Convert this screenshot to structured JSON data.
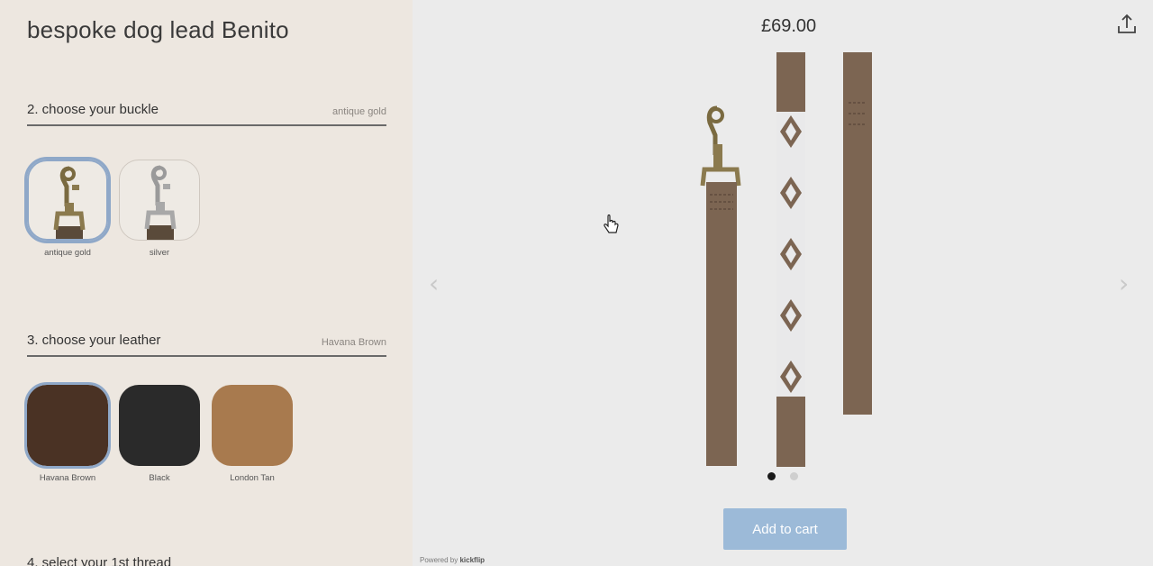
{
  "product": {
    "title": "bespoke dog lead Benito",
    "price": "£69.00"
  },
  "buckle": {
    "heading": "2. choose your buckle",
    "selected": "antique gold",
    "options": [
      {
        "label": "antique gold",
        "color": "#8b7a4e"
      },
      {
        "label": "silver",
        "color": "#9a9a9a"
      }
    ]
  },
  "leather": {
    "heading": "3. choose your leather",
    "selected": "Havana Brown",
    "options": [
      {
        "label": "Havana Brown",
        "color": "#4a3224"
      },
      {
        "label": "Black",
        "color": "#2a2a2a"
      },
      {
        "label": "London Tan",
        "color": "#a87a4e"
      }
    ]
  },
  "thread": {
    "heading": "4. select your 1st thread"
  },
  "viewer": {
    "add_to_cart": "Add to cart",
    "powered_by": "Powered by",
    "powered_brand": "kickflip",
    "active_slide": 1,
    "slides": 2,
    "icons": {
      "share": "share-icon",
      "prev": "chevron-left-icon",
      "next": "chevron-right-icon",
      "cursor": "hand-pointer-icon"
    }
  },
  "colors": {
    "panel_bg": "#ede7e0",
    "viewer_bg": "#ebebeb",
    "cart_button": "#9cbad8",
    "lead_leather": "#7c6552",
    "selected_outline": "#8fa8c8"
  }
}
